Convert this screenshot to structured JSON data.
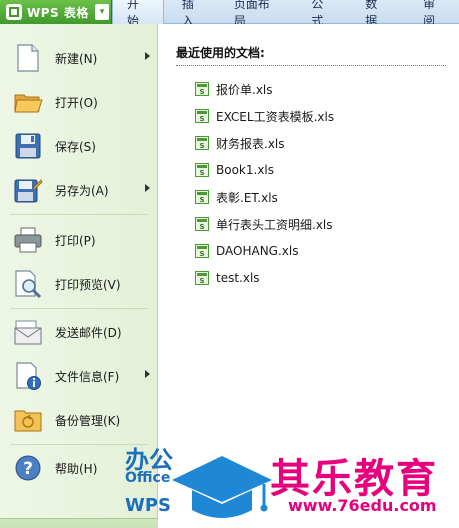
{
  "app": {
    "title": "WPS 表格",
    "dropdown_arrow": "▾"
  },
  "tabs": [
    "开始",
    "插入",
    "页面布局",
    "公式",
    "数据",
    "审阅"
  ],
  "menu": {
    "items": [
      {
        "label": "新建(N)",
        "icon": "new-document-icon",
        "has_submenu": true
      },
      {
        "label": "打开(O)",
        "icon": "open-folder-icon",
        "has_submenu": false
      },
      {
        "label": "保存(S)",
        "icon": "save-disk-icon",
        "has_submenu": false
      },
      {
        "label": "另存为(A)",
        "icon": "save-as-icon",
        "has_submenu": true
      },
      {
        "label": "打印(P)",
        "icon": "printer-icon",
        "has_submenu": false
      },
      {
        "label": "打印预览(V)",
        "icon": "print-preview-icon",
        "has_submenu": false
      },
      {
        "label": "发送邮件(D)",
        "icon": "mail-envelope-icon",
        "has_submenu": false
      },
      {
        "label": "文件信息(F)",
        "icon": "file-info-icon",
        "has_submenu": true
      },
      {
        "label": "备份管理(K)",
        "icon": "backup-folder-icon",
        "has_submenu": false
      },
      {
        "label": "帮助(H)",
        "icon": "help-icon",
        "has_submenu": false
      }
    ]
  },
  "recent": {
    "title": "最近使用的文档:",
    "files": [
      "报价单.xls",
      "EXCEL工资表模板.xls",
      "财务报表.xls",
      "Book1.xls",
      "表彰.ET.xls",
      "单行表头工资明细.xls",
      "DAOHANG.xls",
      "test.xls"
    ]
  },
  "watermark": {
    "office_line1": "办公",
    "office_line2": "Office",
    "office_line3": "WPS",
    "site_name": "其乐教育",
    "site_url": "www.76edu.com"
  },
  "colors": {
    "accent_green": "#3f9a2a",
    "menu_bg": "#e3f0d6",
    "ribbon_blue": "#c8dcf0",
    "watermark_magenta": "#e6007e",
    "watermark_blue": "#1b6fbd"
  }
}
